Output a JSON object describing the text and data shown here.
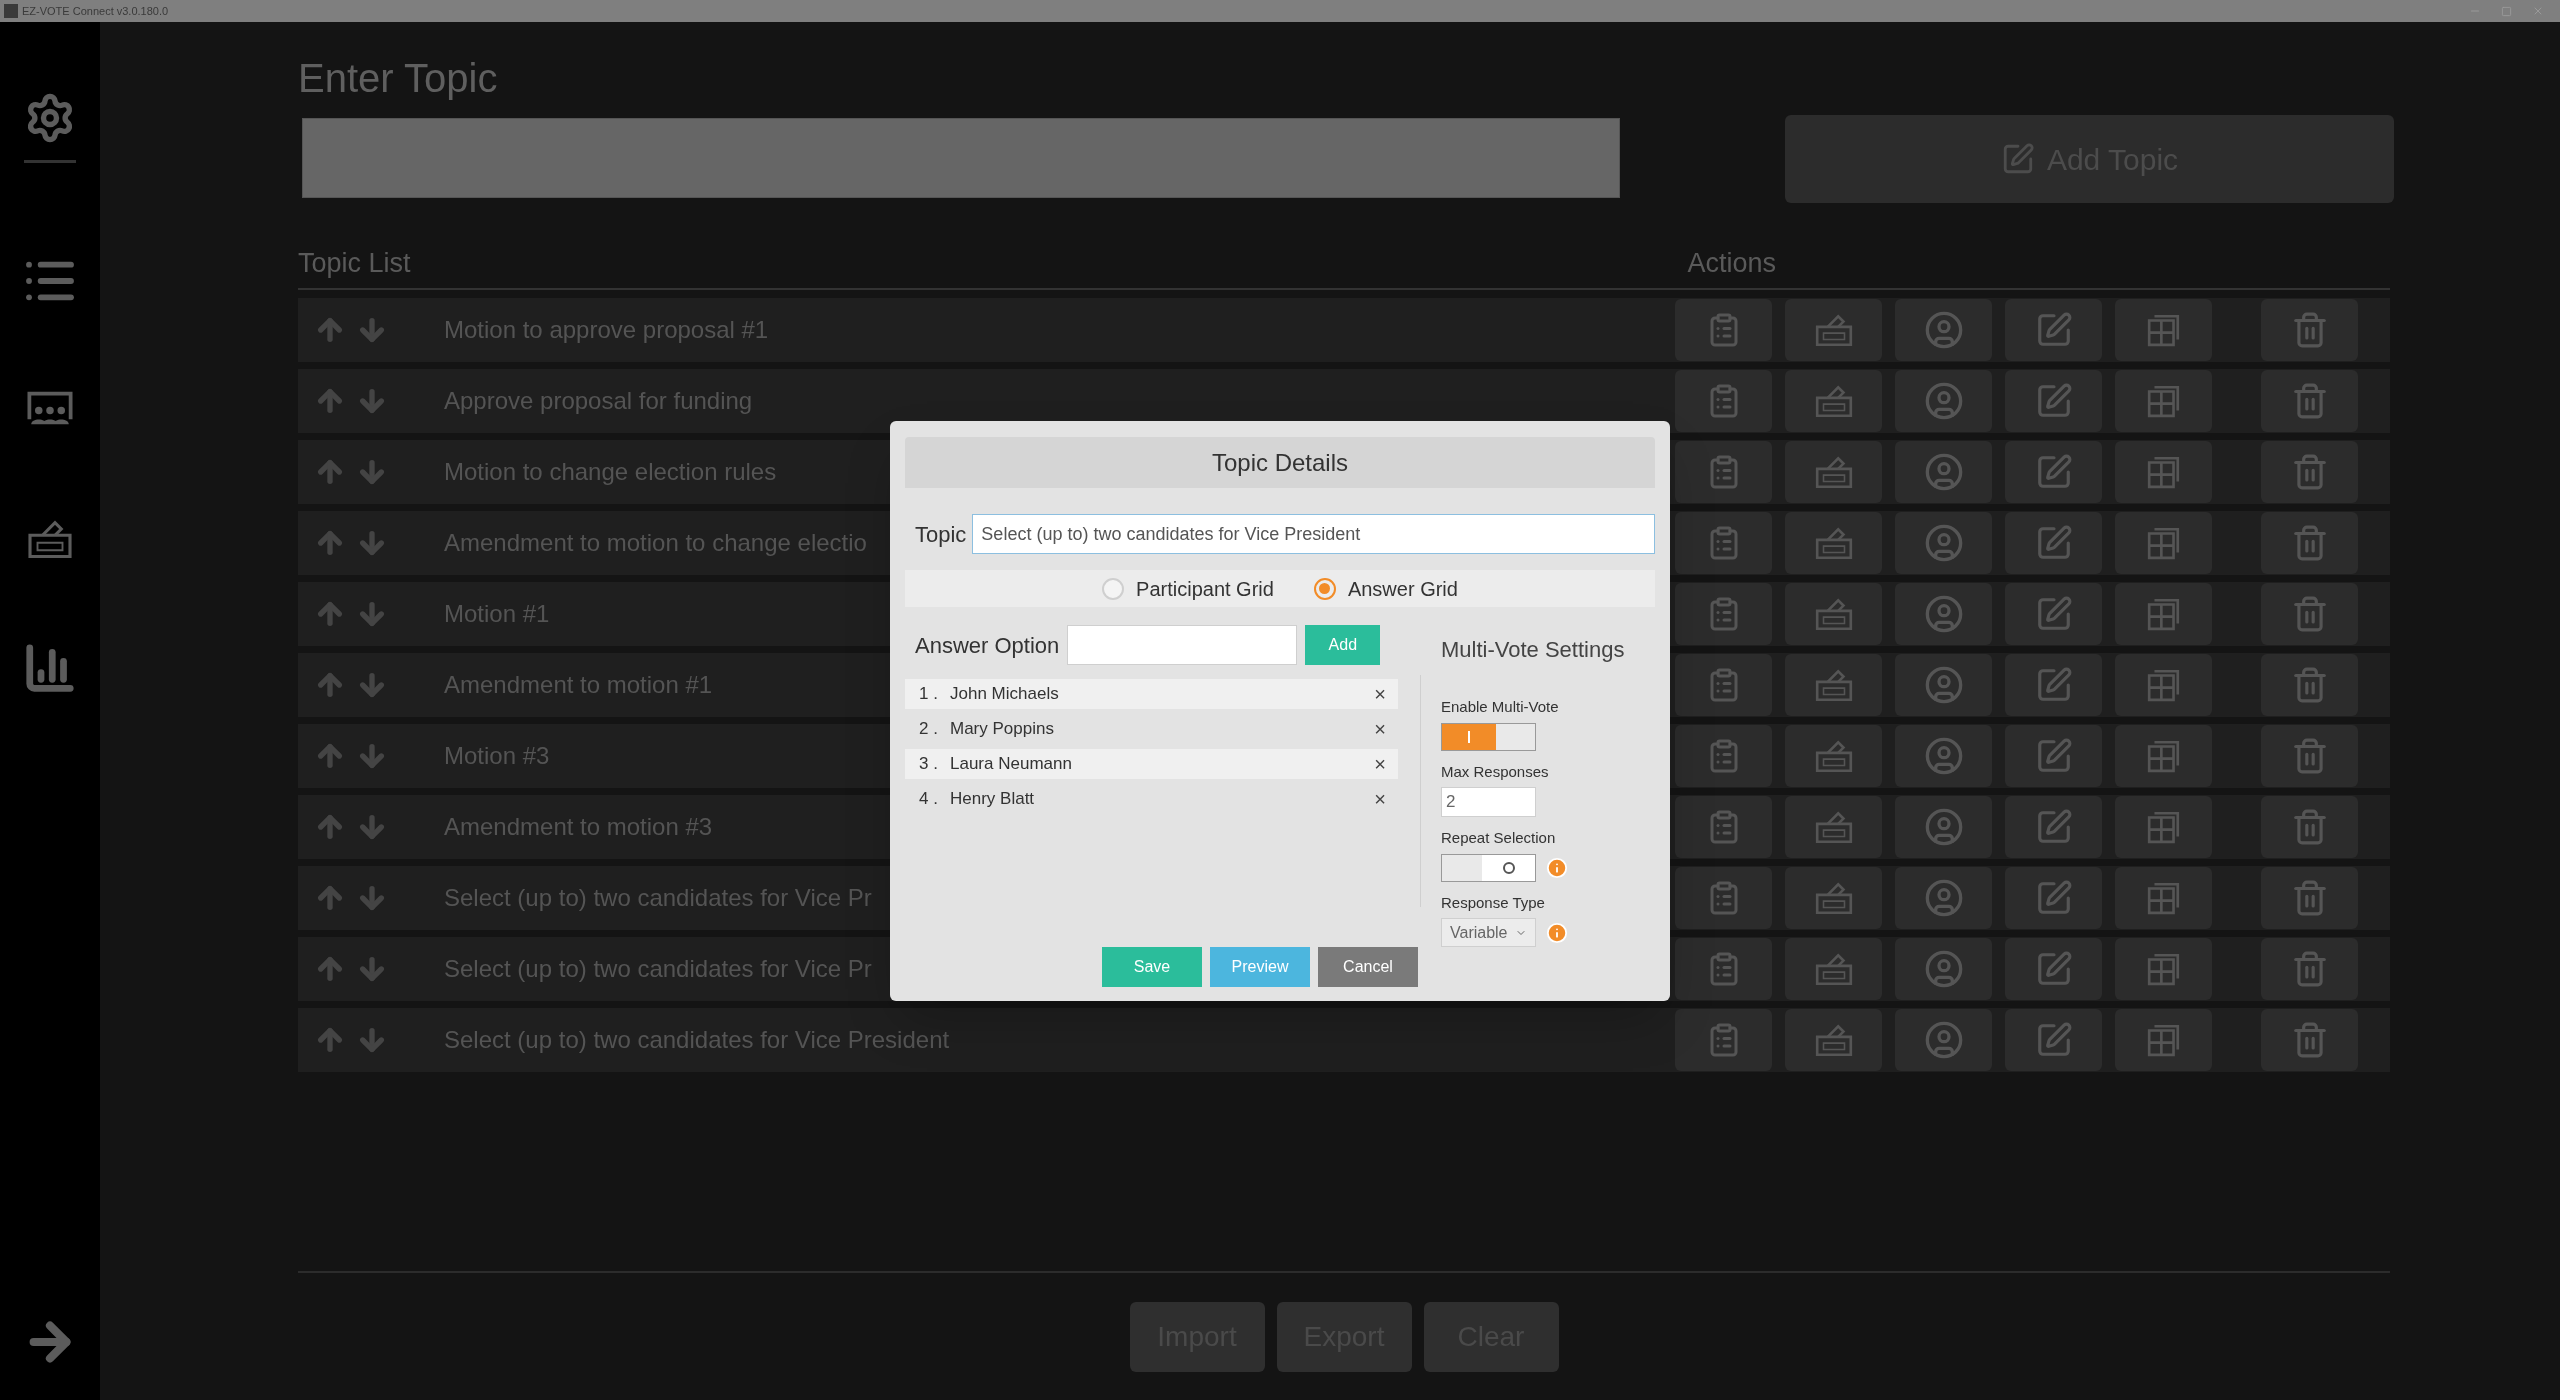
{
  "window": {
    "title": "EZ-VOTE Connect v3.0.180.0"
  },
  "enter_topic": {
    "heading": "Enter Topic",
    "add_button": "Add Topic"
  },
  "topic_list": {
    "heading": "Topic List",
    "actions_heading": "Actions",
    "rows": [
      {
        "title": "Motion to approve proposal #1"
      },
      {
        "title": "Approve proposal for funding"
      },
      {
        "title": "Motion to change election rules"
      },
      {
        "title": "Amendment to motion to change electio"
      },
      {
        "title": "Motion #1"
      },
      {
        "title": "Amendment to motion #1"
      },
      {
        "title": "Motion #3"
      },
      {
        "title": "Amendment to motion #3"
      },
      {
        "title": "Select (up to) two candidates for Vice Pr"
      },
      {
        "title": "Select (up to) two candidates for Vice Pr"
      },
      {
        "title": "Select (up to) two candidates for Vice President"
      }
    ]
  },
  "footer": {
    "buttons": [
      "Import",
      "Export",
      "Clear"
    ]
  },
  "dialog": {
    "title": "Topic Details",
    "topic_label": "Topic",
    "topic_value": "Select (up to) two candidates for Vice President",
    "grid_options": [
      {
        "label": "Participant Grid",
        "selected": false
      },
      {
        "label": "Answer Grid",
        "selected": true
      }
    ],
    "answer_option_label": "Answer Option",
    "add_button": "Add",
    "answers": [
      {
        "number": "1 .",
        "name": "John Michaels",
        "remove": "×"
      },
      {
        "number": "2 .",
        "name": "Mary Poppins",
        "remove": "×"
      },
      {
        "number": "3 .",
        "name": "Laura Neumann",
        "remove": "×"
      },
      {
        "number": "4 .",
        "name": "Henry Blatt",
        "remove": "×"
      }
    ],
    "multi_vote": {
      "heading": "Multi-Vote Settings",
      "enable_label": "Enable Multi-Vote",
      "enable_on": true,
      "max_label": "Max Responses",
      "max_value": "2",
      "repeat_label": "Repeat Selection",
      "repeat_on": false,
      "response_type_label": "Response Type",
      "response_type_value": "Variable"
    },
    "buttons": [
      {
        "label": "Save",
        "kind": "save"
      },
      {
        "label": "Preview",
        "kind": "preview"
      },
      {
        "label": "Cancel",
        "kind": "cancel"
      }
    ]
  }
}
